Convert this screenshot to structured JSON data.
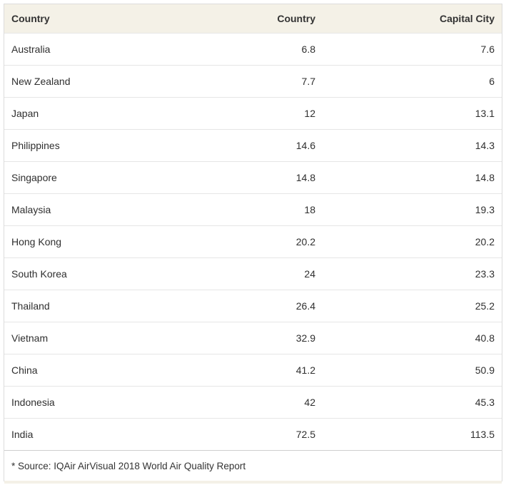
{
  "table": {
    "headers": [
      "Country",
      "Country",
      "Capital City"
    ],
    "rows": [
      {
        "name": "Australia",
        "country": "6.8",
        "capital": "7.6"
      },
      {
        "name": "New Zealand",
        "country": "7.7",
        "capital": "6"
      },
      {
        "name": "Japan",
        "country": "12",
        "capital": "13.1"
      },
      {
        "name": "Philippines",
        "country": "14.6",
        "capital": "14.3"
      },
      {
        "name": "Singapore",
        "country": "14.8",
        "capital": "14.8"
      },
      {
        "name": "Malaysia",
        "country": "18",
        "capital": "19.3"
      },
      {
        "name": "Hong Kong",
        "country": "20.2",
        "capital": "20.2"
      },
      {
        "name": "South Korea",
        "country": "24",
        "capital": "23.3"
      },
      {
        "name": "Thailand",
        "country": "26.4",
        "capital": "25.2"
      },
      {
        "name": "Vietnam",
        "country": "32.9",
        "capital": "40.8"
      },
      {
        "name": "China",
        "country": "41.2",
        "capital": "50.9"
      },
      {
        "name": "Indonesia",
        "country": "42",
        "capital": "45.3"
      },
      {
        "name": "India",
        "country": "72.5",
        "capital": "113.5"
      }
    ],
    "footnote": "* Source: IQAir AirVisual 2018 World Air Quality Report"
  },
  "colors": {
    "header_bg": "#f4f1e7",
    "row_border": "#e6e6e6",
    "outer_border": "#dcdcdc"
  }
}
